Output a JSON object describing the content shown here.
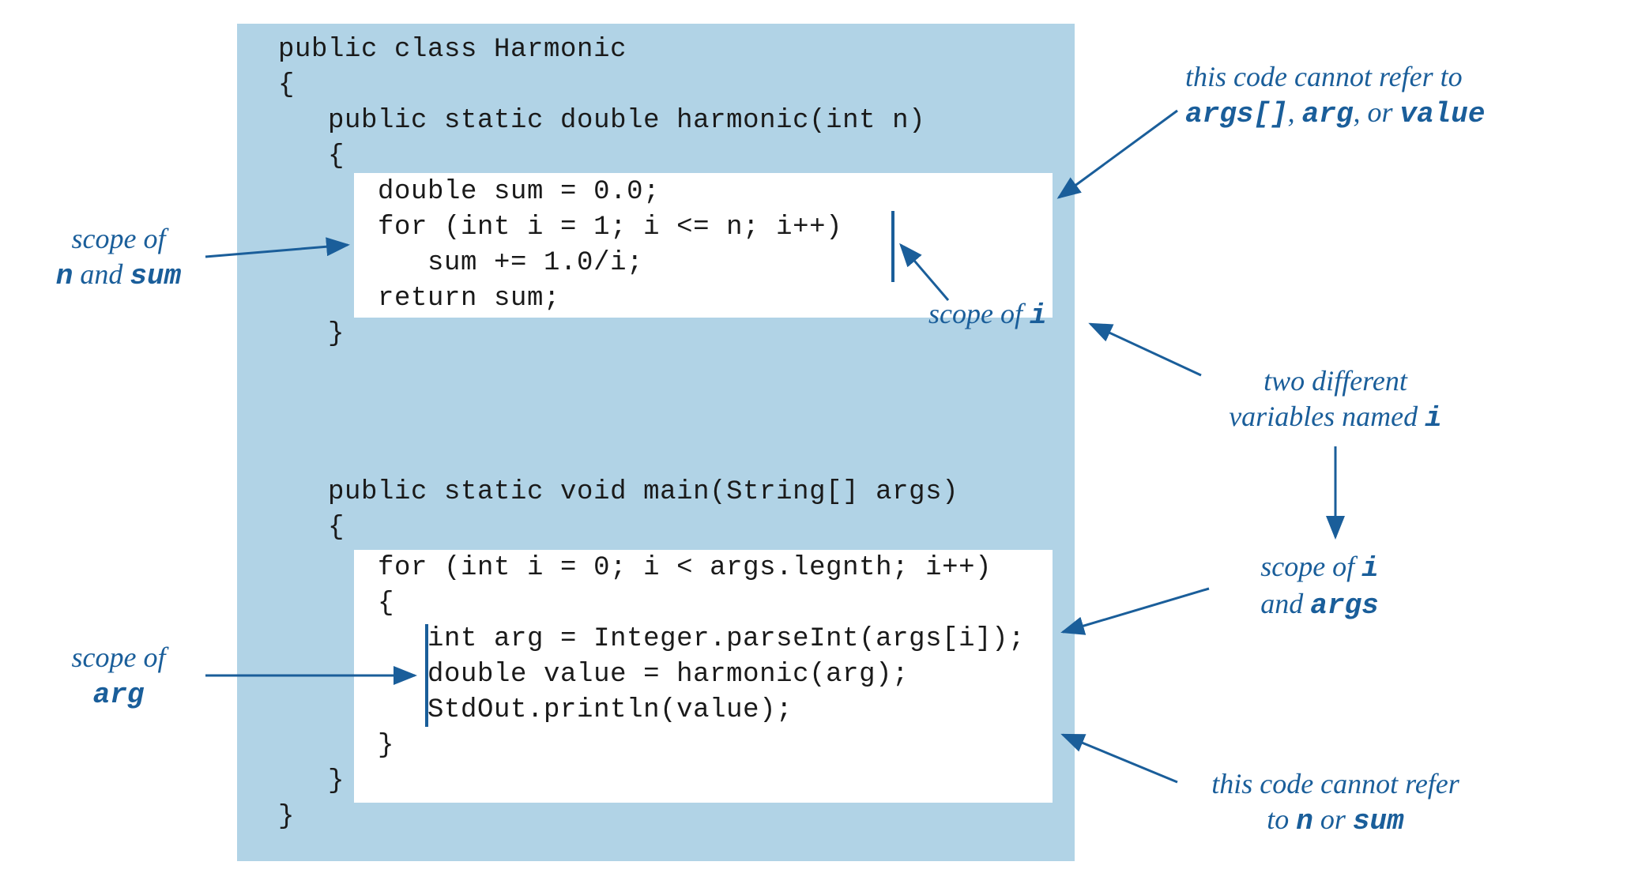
{
  "code": {
    "l1": "public class Harmonic",
    "l2": "{",
    "l3": "   public static double harmonic(int n)",
    "l4": "   {",
    "l5": "      double sum = 0.0;",
    "l6": "      for (int i = 1; i <= n; i++)",
    "l7": "         sum += 1.0/i;",
    "l8": "      return sum;",
    "l9": "   }",
    "l10": "   public static void main(String[] args)",
    "l11": "   {",
    "l12": "      for (int i = 0; i < args.legnth; i++)",
    "l13": "      {",
    "l14": "         int arg = Integer.parseInt(args[i]);",
    "l15": "         double value = harmonic(arg);",
    "l16": "         StdOut.println(value);",
    "l17": "      }",
    "l18": "   }",
    "l19": "}"
  },
  "annotations": {
    "cannot_refer_args_pre": "this code cannot refer to",
    "cannot_refer_args_args": "args[]",
    "cannot_refer_args_sep1": ", ",
    "cannot_refer_args_arg": "arg",
    "cannot_refer_args_sep2": ", or ",
    "cannot_refer_args_value": "value",
    "scope_n_sum_pre": "scope of",
    "scope_n_sum_n": "n",
    "scope_n_sum_and": " and ",
    "scope_n_sum_sum": "sum",
    "scope_i_pre": "scope of ",
    "scope_i_i": "i",
    "two_i_pre": "two different",
    "two_i_mid": "variables named ",
    "two_i_i": "i",
    "scope_i_args_pre": "scope of ",
    "scope_i_args_i": "i",
    "scope_i_args_and": "and ",
    "scope_i_args_args": "args",
    "scope_arg_pre": "scope of",
    "scope_arg_arg": "arg",
    "cannot_refer_n_pre": "this code cannot refer",
    "cannot_refer_n_mid": "to ",
    "cannot_refer_n_n": "n",
    "cannot_refer_n_or": " or ",
    "cannot_refer_n_sum": "sum"
  },
  "colors": {
    "boxBlue": "#b1d3e6",
    "annotBlue": "#1a5e9a",
    "codeText": "#1a1a1a"
  }
}
